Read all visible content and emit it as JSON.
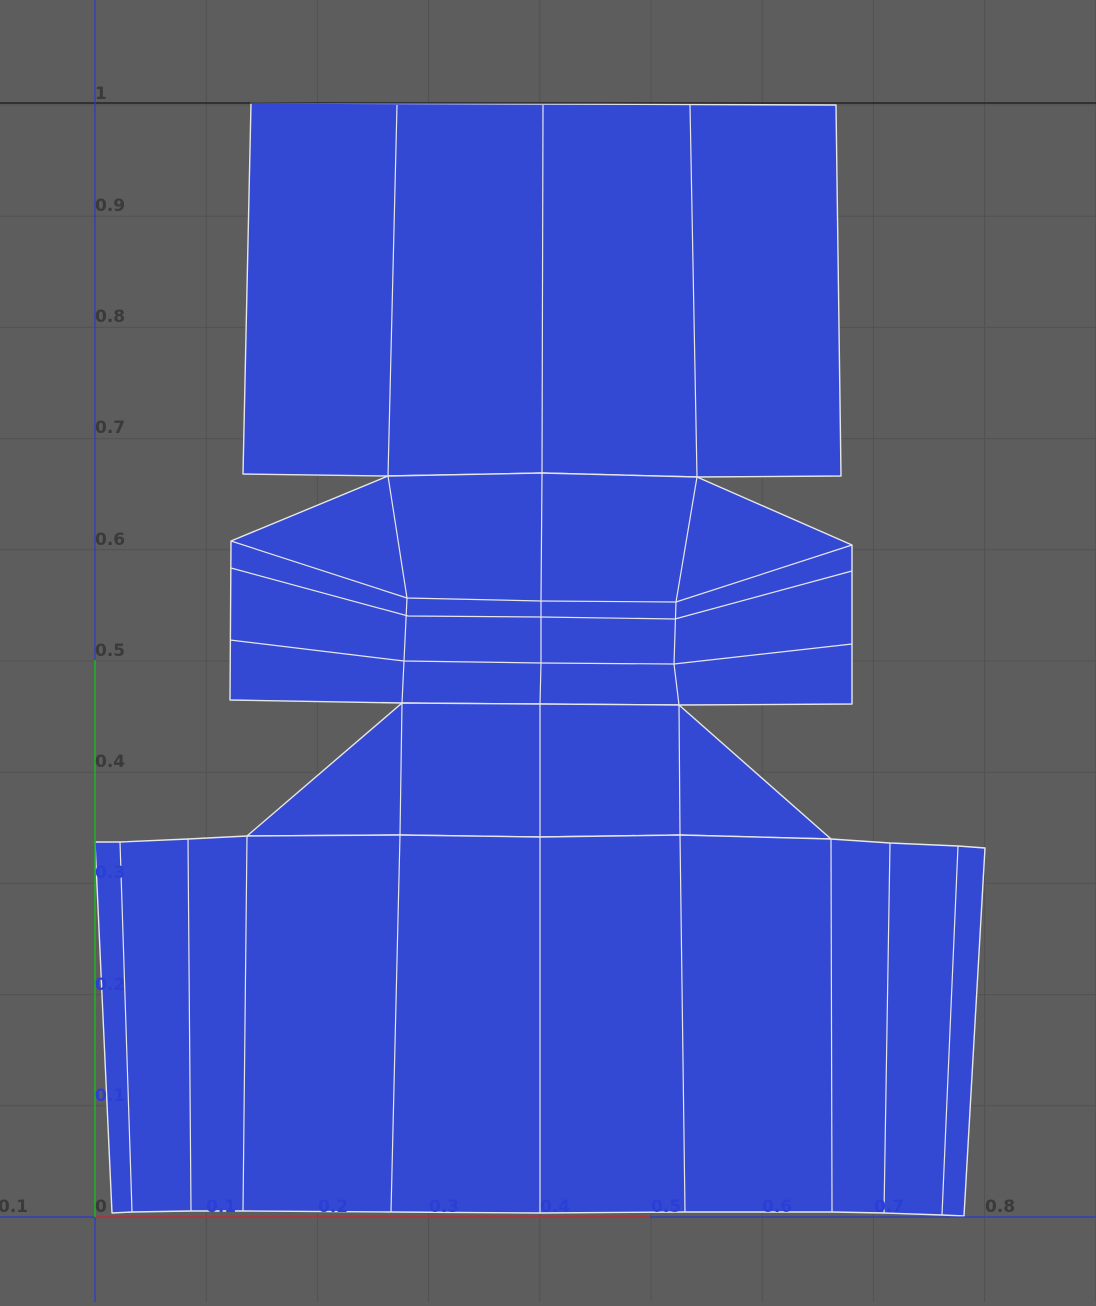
{
  "editor": {
    "x_ticks": [
      "0.1",
      "0",
      "0.1",
      "0.2",
      "0.3",
      "0.4",
      "0.5",
      "0.6",
      "0.7",
      "0.8"
    ],
    "y_ticks": [
      "0.1",
      "0.2",
      "0.3",
      "0.4",
      "0.5",
      "0.6",
      "0.7",
      "0.8",
      "0.9",
      "1"
    ],
    "colors": {
      "background": "#5d5d5d",
      "grid": "#525252",
      "uv_fill": "#3349d4",
      "uv_edge": "#e6e6e6",
      "u_axis": "#c03030",
      "v_axis": "#22b022",
      "frame_axis": "#2a3ad0",
      "tick_label_dark": "#3a3a3a",
      "tick_label_overlap": "#2a3fd6"
    }
  }
}
